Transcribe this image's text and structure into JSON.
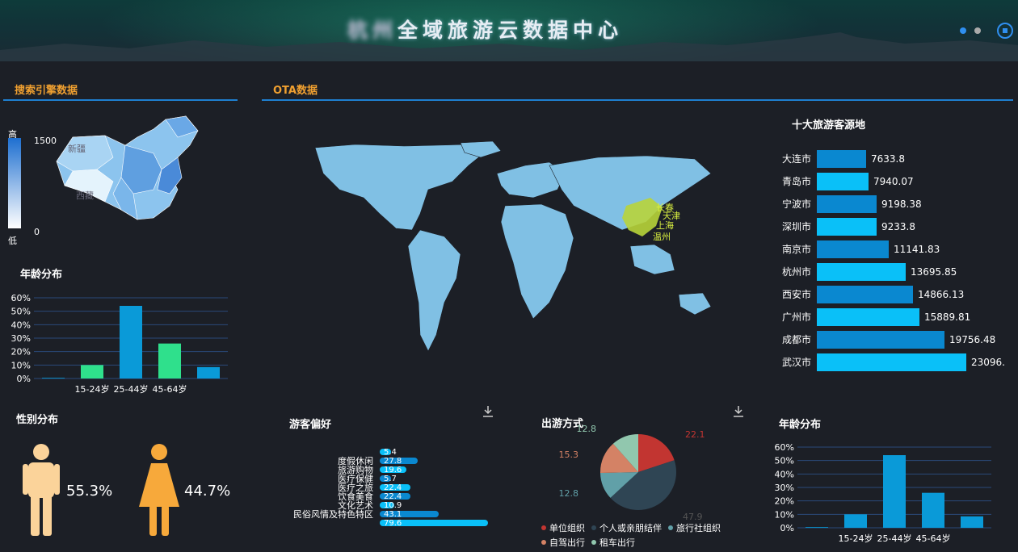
{
  "header": {
    "title_blurred": "杭州",
    "title_main": "全域旅游云数据中心"
  },
  "search_section": {
    "title": "搜索引擎数据",
    "map_legend": {
      "high": "高",
      "low": "低",
      "max": "1500",
      "min": "0"
    },
    "map_labels": [
      "新疆",
      "西藏"
    ],
    "age_title": "年龄分布"
  },
  "age_chart_left": {
    "y_ticks": [
      "60%",
      "50%",
      "40%",
      "30%",
      "20%",
      "10%",
      "0%"
    ],
    "x_labels": [
      "15-24岁",
      "25-44岁",
      "45-64岁"
    ]
  },
  "gender": {
    "title": "性别分布",
    "male": "55.3%",
    "female": "44.7%"
  },
  "ota": {
    "title": "OTA数据",
    "map_city_labels": [
      "长春",
      "天津",
      "上海",
      "温州"
    ]
  },
  "top_cities": {
    "title": "十大旅游客源地",
    "items": [
      {
        "name": "大连市",
        "value": "7633.8"
      },
      {
        "name": "青岛市",
        "value": "7940.07"
      },
      {
        "name": "宁波市",
        "value": "9198.38"
      },
      {
        "name": "深圳市",
        "value": "9233.8"
      },
      {
        "name": "南京市",
        "value": "11141.83"
      },
      {
        "name": "杭州市",
        "value": "13695.85"
      },
      {
        "name": "西安市",
        "value": "14866.13"
      },
      {
        "name": "广州市",
        "value": "15889.81"
      },
      {
        "name": "成都市",
        "value": "19756.48"
      },
      {
        "name": "武汉市",
        "value": "23096."
      }
    ]
  },
  "preference": {
    "title": "游客偏好",
    "items": [
      {
        "label": "",
        "value": "5.4"
      },
      {
        "label": "度假休闲",
        "value": "27.8"
      },
      {
        "label": "旅游购物",
        "value": "19.6"
      },
      {
        "label": "医疗保健",
        "value": "5.7"
      },
      {
        "label": "医疗之旅",
        "value": "22.4"
      },
      {
        "label": "饮食美食",
        "value": "22.4"
      },
      {
        "label": "文化艺术",
        "value": "10.9"
      },
      {
        "label": "民俗风情及特色特区",
        "value": "43.1"
      },
      {
        "label": "",
        "value": "79.6"
      }
    ]
  },
  "travel_mode": {
    "title": "出游方式",
    "labels": {
      "a": "22.1",
      "b": "47.9",
      "c": "12.8",
      "d": "15.3",
      "e": "12.8"
    },
    "legend": [
      "单位组织",
      "个人或亲朋结伴",
      "旅行社组织",
      "自驾出行",
      "租车出行"
    ],
    "colors": [
      "#c23531",
      "#2f4554",
      "#61a0a8",
      "#d48265",
      "#91c7ae"
    ]
  },
  "age_chart_right": {
    "title": "年龄分布",
    "y_ticks": [
      "60%",
      "50%",
      "40%",
      "30%",
      "20%",
      "10%",
      "0%"
    ],
    "x_labels": [
      "15-24岁",
      "25-44岁",
      "45-64岁"
    ]
  },
  "chart_data": [
    {
      "type": "bar",
      "categories": [
        "",
        "15-24岁",
        "25-44岁",
        "45-64岁",
        ""
      ],
      "values": [
        0.5,
        10,
        54,
        26,
        8.5
      ],
      "ylim": [
        0,
        60
      ]
    },
    {
      "type": "bar",
      "categories": [
        "",
        "15-24岁",
        "25-44岁",
        "45-64岁",
        ""
      ],
      "values": [
        0.5,
        10,
        54,
        26,
        8.5
      ],
      "ylim": [
        0,
        60
      ]
    },
    {
      "type": "bar",
      "categories": [
        "大连市",
        "青岛市",
        "宁波市",
        "深圳市",
        "南京市",
        "杭州市",
        "西安市",
        "广州市",
        "成都市",
        "武汉市"
      ],
      "values": [
        7633.8,
        7940.07,
        9198.38,
        9233.8,
        11141.83,
        13695.85,
        14866.13,
        15889.81,
        19756.48,
        23096
      ]
    },
    {
      "type": "bar",
      "categories": [
        "",
        "度假休闲",
        "旅游购物",
        "医疗保健",
        "医疗之旅",
        "饮食美食",
        "文化艺术",
        "民俗风情及特色特区",
        ""
      ],
      "values": [
        5.4,
        27.8,
        19.6,
        5.7,
        22.4,
        22.4,
        10.9,
        43.1,
        79.6
      ]
    },
    {
      "type": "pie",
      "categories": [
        "单位组织",
        "个人或亲朋结伴",
        "旅行社组织",
        "自驾出行",
        "租车出行"
      ],
      "values": [
        22.1,
        47.9,
        12.8,
        15.3,
        12.8
      ]
    }
  ]
}
